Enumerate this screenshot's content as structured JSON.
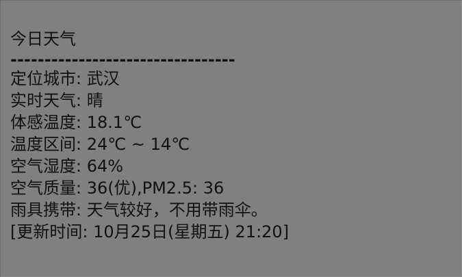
{
  "title": "今日天气",
  "divider": "---------------------------------",
  "weather": [
    {
      "label": "定位城市:",
      "value": "武汉"
    },
    {
      "label": "实时天气:",
      "value": "晴"
    },
    {
      "label": "体感温度:",
      "value": "18.1℃"
    },
    {
      "label": "温度区间:",
      "value": "24℃ ~ 14℃"
    },
    {
      "label": "空气湿度:",
      "value": "64%"
    },
    {
      "label": "空气质量:",
      "value": "36(优),PM2.5: 36"
    },
    {
      "label": "雨具携带:",
      "value": "天气较好，不用带雨伞。"
    }
  ],
  "update": {
    "label": "[更新时间:",
    "value": "10月25日(星期五) 21:20]"
  }
}
